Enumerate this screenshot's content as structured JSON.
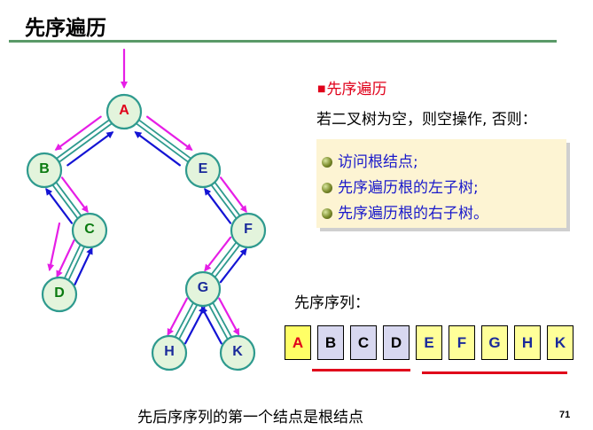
{
  "title": "先序遍历",
  "colors": {
    "accent_red": "#e0001a",
    "rule_green": "#5a9a68",
    "node_fill": "#e3f4dc",
    "edge_teal": "#2e9a8e",
    "arrow_blue": "#1414d4",
    "arrow_magenta": "#e61ee6",
    "root_label": "#e0001a",
    "left_label": "#0a7a10",
    "right_label": "#1a2a9a",
    "cell_root": "#ffff66",
    "cell_left": "#d8d8f0",
    "cell_right": "#ffff99"
  },
  "tree": {
    "nodes": [
      {
        "id": "A",
        "label": "A",
        "role": "root"
      },
      {
        "id": "B",
        "label": "B",
        "role": "left"
      },
      {
        "id": "C",
        "label": "C",
        "role": "left"
      },
      {
        "id": "D",
        "label": "D",
        "role": "left"
      },
      {
        "id": "E",
        "label": "E",
        "role": "right"
      },
      {
        "id": "F",
        "label": "F",
        "role": "right"
      },
      {
        "id": "G",
        "label": "G",
        "role": "right"
      },
      {
        "id": "H",
        "label": "H",
        "role": "right"
      },
      {
        "id": "K",
        "label": "K",
        "role": "right"
      }
    ],
    "edges": [
      {
        "from": "A",
        "to": "B"
      },
      {
        "from": "A",
        "to": "E"
      },
      {
        "from": "B",
        "to": "C"
      },
      {
        "from": "C",
        "to": "D"
      },
      {
        "from": "E",
        "to": "F"
      },
      {
        "from": "F",
        "to": "G"
      },
      {
        "from": "G",
        "to": "H"
      },
      {
        "from": "G",
        "to": "K"
      }
    ]
  },
  "section": {
    "heading": "先序遍历",
    "description": "若二叉树为空，则空操作, 否则：",
    "steps": [
      "访问根结点;",
      "先序遍历根的左子树;",
      "先序遍历根的右子树。"
    ]
  },
  "sequence": {
    "label": "先序序列：",
    "cells": [
      {
        "label": "A",
        "group": "root"
      },
      {
        "label": "B",
        "group": "left"
      },
      {
        "label": "C",
        "group": "left"
      },
      {
        "label": "D",
        "group": "left"
      },
      {
        "label": "E",
        "group": "right"
      },
      {
        "label": "F",
        "group": "right"
      },
      {
        "label": "G",
        "group": "right"
      },
      {
        "label": "H",
        "group": "right"
      },
      {
        "label": "K",
        "group": "right"
      }
    ]
  },
  "footer": "先后序序列的第一个结点是根结点",
  "page_number": "71"
}
